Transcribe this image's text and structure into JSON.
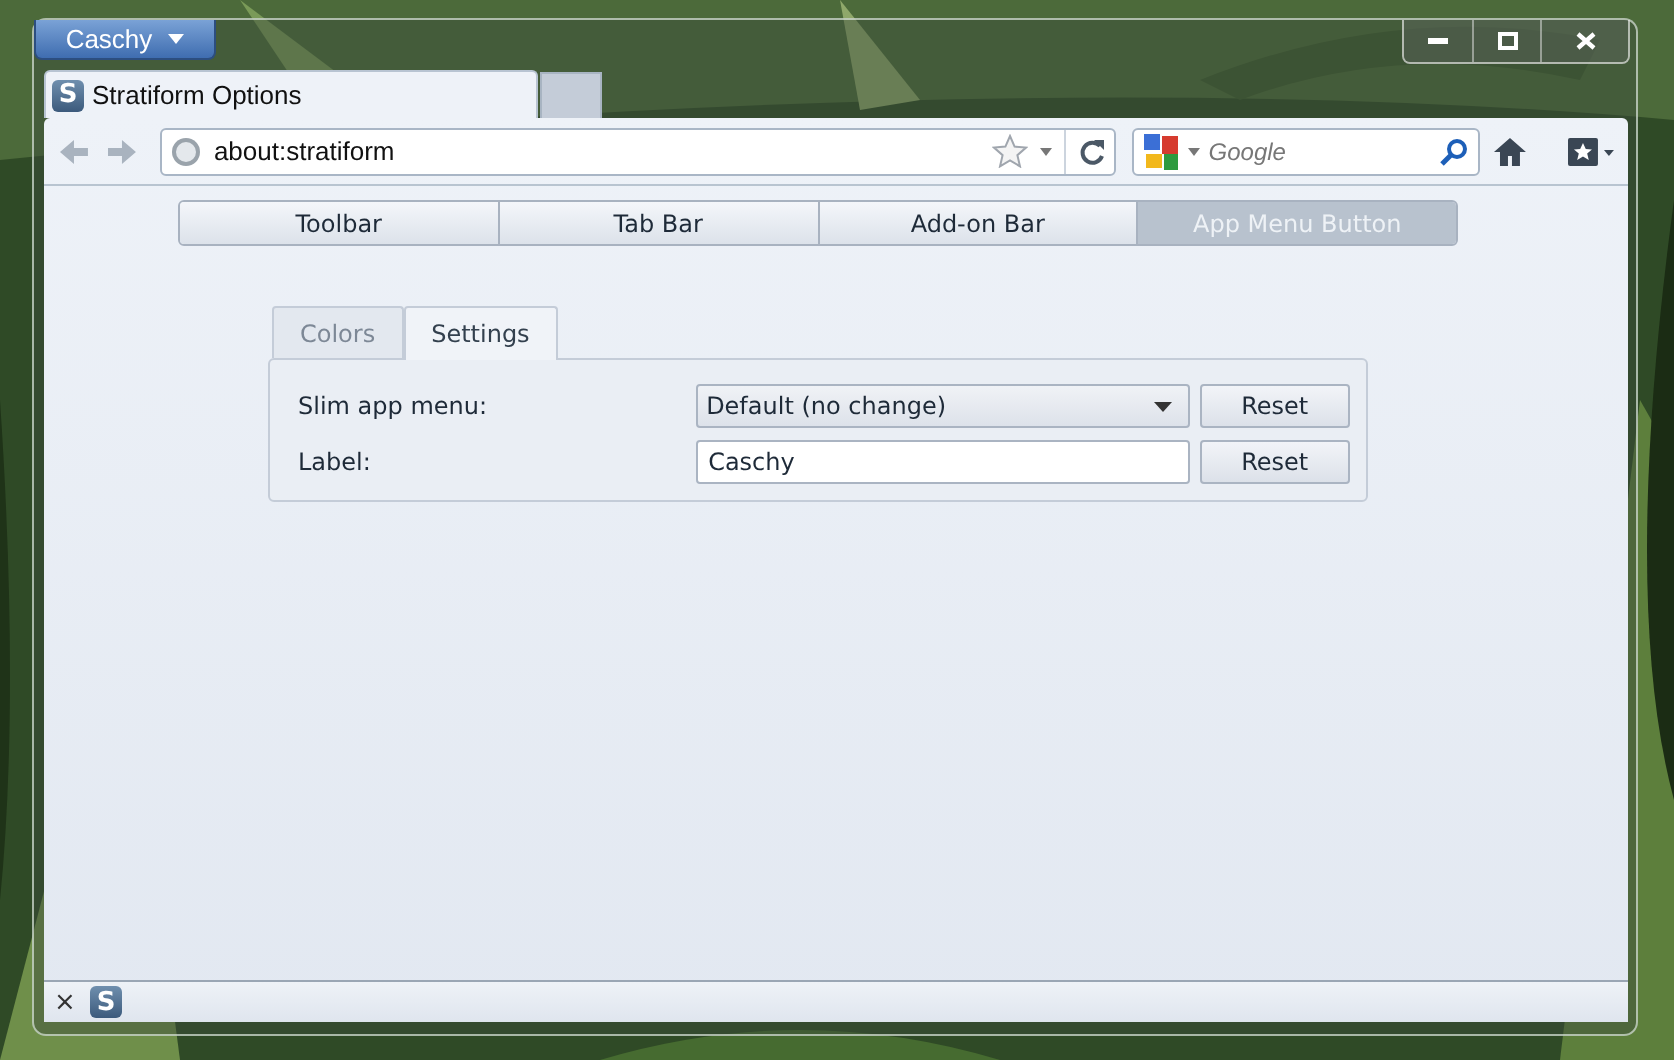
{
  "window": {
    "app_menu_button": "Caschy"
  },
  "tabs": [
    {
      "title": "Stratiform Options",
      "logo_letter": "S",
      "selected": true
    }
  ],
  "navbar": {
    "url": "about:stratiform",
    "search_placeholder": "Google"
  },
  "page": {
    "sections": [
      {
        "label": "Toolbar",
        "selected": false
      },
      {
        "label": "Tab Bar",
        "selected": false
      },
      {
        "label": "Add-on Bar",
        "selected": false
      },
      {
        "label": "App Menu Button",
        "selected": true
      }
    ],
    "subtabs": [
      {
        "label": "Colors",
        "selected": false
      },
      {
        "label": "Settings",
        "selected": true
      }
    ],
    "settings": [
      {
        "kind": "dropdown",
        "label": "Slim app menu:",
        "value": "Default (no change)",
        "button": "Reset"
      },
      {
        "kind": "text",
        "label": "Label:",
        "value": "Caschy",
        "button": "Reset"
      }
    ]
  },
  "addon_bar": {
    "close": "×",
    "logo_letter": "S"
  }
}
